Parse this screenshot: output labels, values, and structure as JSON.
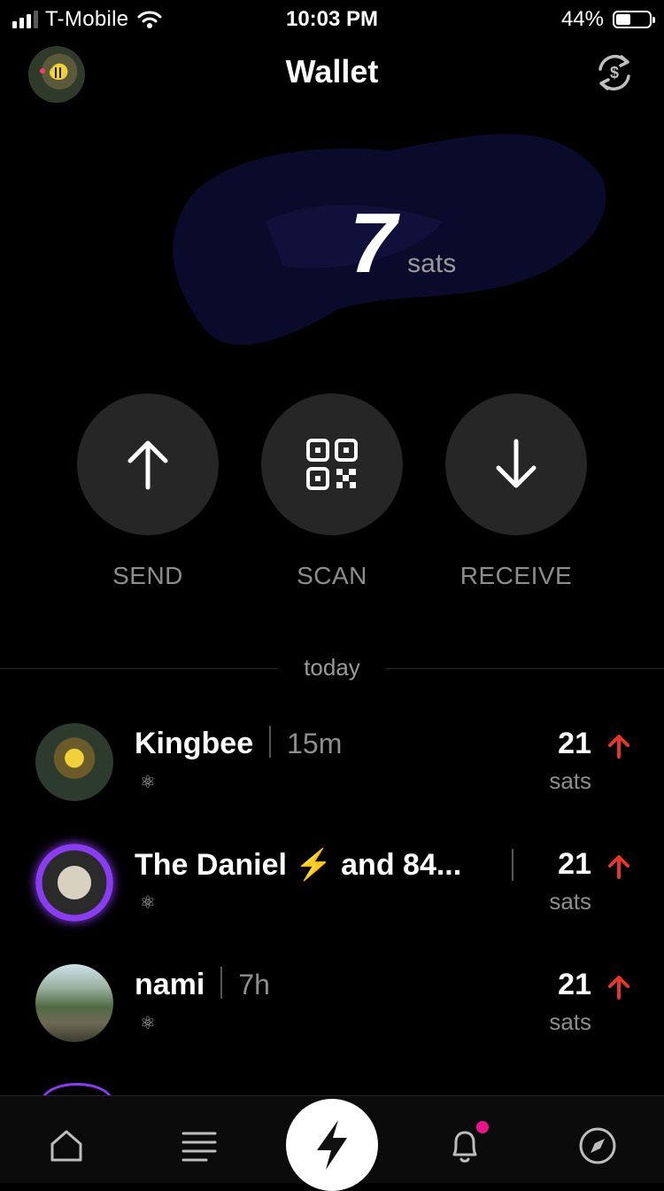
{
  "status_bar": {
    "carrier": "T-Mobile",
    "time": "10:03 PM",
    "battery_percent": "44%",
    "battery_level": 0.44
  },
  "header": {
    "title": "Wallet",
    "avatar_icon": "bee-avatar-icon",
    "swap_icon": "currency-swap-icon"
  },
  "balance": {
    "value": "7",
    "unit": "sats"
  },
  "actions": [
    {
      "label": "SEND",
      "icon": "arrow-up-icon"
    },
    {
      "label": "SCAN",
      "icon": "qr-code-icon"
    },
    {
      "label": "RECEIVE",
      "icon": "arrow-down-icon"
    }
  ],
  "section": {
    "label": "today"
  },
  "transactions": [
    {
      "name": "Kingbee",
      "time": "15m",
      "amount": "21",
      "unit": "sats",
      "direction": "sent"
    },
    {
      "name": "The Daniel ⚡ and 84...",
      "time": "",
      "amount": "21",
      "unit": "sats",
      "direction": "sent"
    },
    {
      "name": "nami",
      "time": "7h",
      "amount": "21",
      "unit": "sats",
      "direction": "sent"
    }
  ],
  "colors": {
    "background": "#000000",
    "sent_arrow": "#e0392b",
    "notification_dot": "#e6168a",
    "action_circle": "#262626"
  },
  "tab_bar": {
    "items": [
      "home-icon",
      "feed-icon",
      "lightning-icon",
      "bell-icon",
      "compass-icon"
    ]
  }
}
